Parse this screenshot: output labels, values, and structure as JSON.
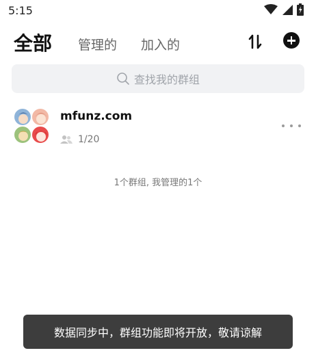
{
  "status_bar": {
    "time": "5:15",
    "icons": [
      "wifi-icon",
      "signal-icon",
      "battery-icon"
    ]
  },
  "header": {
    "tabs": [
      {
        "label": "全部",
        "active": true
      },
      {
        "label": "管理的",
        "active": false
      },
      {
        "label": "加入的",
        "active": false
      }
    ],
    "sort_icon": "sort-icon",
    "add_icon": "add-circle-icon"
  },
  "search": {
    "placeholder": "查找我的群组",
    "icon": "search-icon"
  },
  "groups": [
    {
      "name": "mfunz.com",
      "members": "1/20",
      "member_icon": "people-icon",
      "more_icon": "more-dots-icon"
    }
  ],
  "summary_text": "1个群组, 我管理的1个",
  "toast": {
    "text": "数据同步中，群组功能即将开放，敬请谅解"
  },
  "colors": {
    "toast_bg": "#3d3d3d",
    "search_bg": "#f1f2f4",
    "muted_text": "#777777"
  }
}
